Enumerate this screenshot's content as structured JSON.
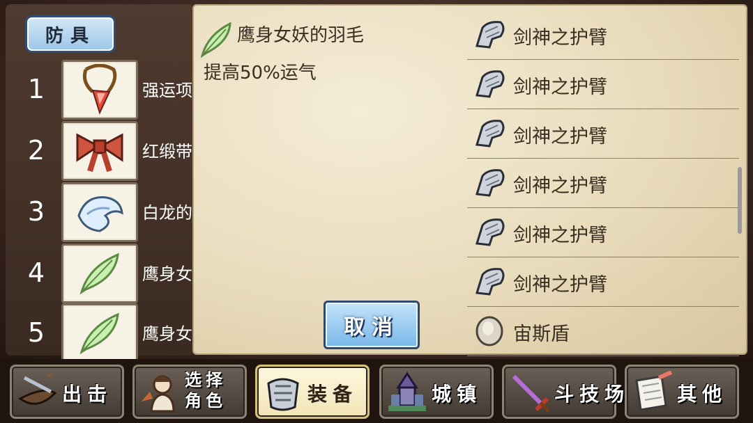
{
  "category_tab": "防具",
  "slots": [
    {
      "num": "1",
      "name": "强运项",
      "icon": "necklace-icon"
    },
    {
      "num": "2",
      "name": "红缎带",
      "icon": "ribbon-icon"
    },
    {
      "num": "3",
      "name": "白龙的",
      "icon": "dragon-scale-icon"
    },
    {
      "num": "4",
      "name": "鹰身女",
      "icon": "feather-icon"
    },
    {
      "num": "5",
      "name": "鹰身女",
      "icon": "feather-icon"
    }
  ],
  "detail": {
    "title": "鹰身女妖的羽毛",
    "title_icon": "feather-icon",
    "description": "提高50%运气",
    "cancel_label": "取消"
  },
  "inventory": [
    {
      "name": "剑神之护臂",
      "icon": "gauntlet-icon"
    },
    {
      "name": "剑神之护臂",
      "icon": "gauntlet-icon"
    },
    {
      "name": "剑神之护臂",
      "icon": "gauntlet-icon"
    },
    {
      "name": "剑神之护臂",
      "icon": "gauntlet-icon"
    },
    {
      "name": "剑神之护臂",
      "icon": "gauntlet-icon"
    },
    {
      "name": "剑神之护臂",
      "icon": "gauntlet-icon"
    },
    {
      "name": "宙斯盾",
      "icon": "shield-icon"
    }
  ],
  "menu": [
    {
      "label": "出击",
      "icon": "sortie-icon",
      "active": false
    },
    {
      "label": "选择角色",
      "icon": "character-select-icon",
      "active": false
    },
    {
      "label": "装备",
      "icon": "armor-icon",
      "active": true
    },
    {
      "label": "城镇",
      "icon": "town-icon",
      "active": false
    },
    {
      "label": "斗技场",
      "icon": "arena-sword-icon",
      "active": false
    },
    {
      "label": "其他",
      "icon": "scroll-icon",
      "active": false
    }
  ]
}
